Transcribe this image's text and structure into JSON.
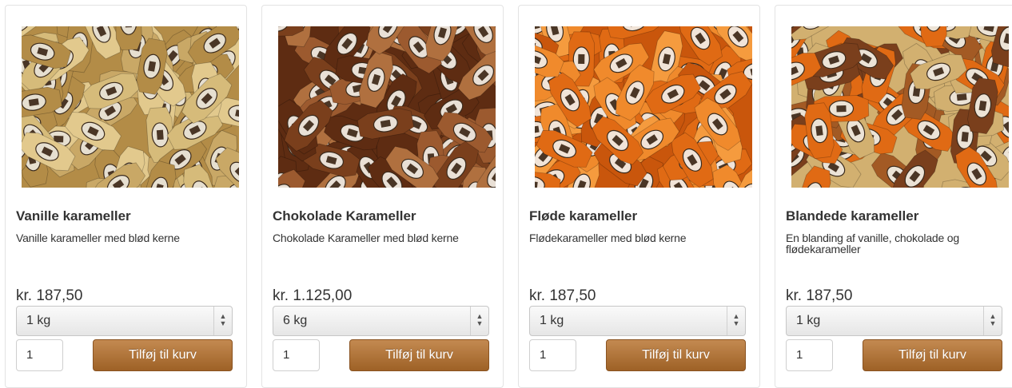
{
  "products": [
    {
      "title": "Vanille karameller",
      "description": "Vanille karameller med blød kerne",
      "price": "kr. 187,50",
      "size": "1 kg",
      "quantity": "1",
      "add_label": "Tilføj til kurv",
      "wrapper_colors": [
        "#c9a866",
        "#e2c98d",
        "#b38c47",
        "#d6bb7a"
      ],
      "label_color": "#e6dfd0"
    },
    {
      "title": "Chokolade Karameller",
      "description": "Chokolade Karameller med blød kerne",
      "price": "kr. 1.125,00",
      "size": "6 kg",
      "quantity": "1",
      "add_label": "Tilføj til kurv",
      "wrapper_colors": [
        "#7a3f1c",
        "#9c5a2f",
        "#5e2c12",
        "#b0703f"
      ],
      "label_color": "#e9e0d6"
    },
    {
      "title": "Fløde karameller",
      "description": "Flødekarameller med blød kerne",
      "price": "kr. 187,50",
      "size": "1 kg",
      "quantity": "1",
      "add_label": "Tilføj til kurv",
      "wrapper_colors": [
        "#e06a14",
        "#f08a2c",
        "#c9560c",
        "#f59b3e"
      ],
      "label_color": "#f1e4d8"
    },
    {
      "title": "Blandede karameller",
      "description": "En blanding af vanille, chokolade og flødekarameller",
      "price": "kr. 187,50",
      "size": "1 kg",
      "quantity": "1",
      "add_label": "Tilføj til kurv",
      "wrapper_colors": [
        "#7a3f1c",
        "#e06a14",
        "#d2b070",
        "#a35a24"
      ],
      "label_color": "#ece3d6"
    }
  ]
}
